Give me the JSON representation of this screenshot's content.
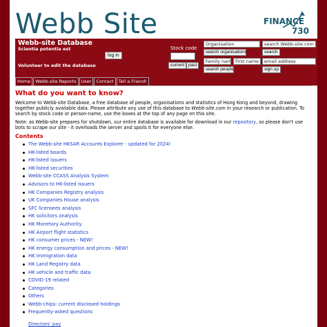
{
  "header": {
    "brand": "Webb Site",
    "finance_logo_top": "FINANCE",
    "finance_logo_num": "730"
  },
  "banner": {
    "title": "Webb-site Database",
    "motto": "Scientia potentia est",
    "login_label": "log in",
    "volunteer": "Volunteer to edit the database",
    "stock_code_label": "Stock code",
    "current_label": "current",
    "past_label": "past",
    "organisation_value": "Organisation",
    "search_orgs_label": "search organisations",
    "family_name_value": "Family name",
    "first_name_value": "First name",
    "search_people_label": "search people",
    "site_search_value": "search Webb-site.com",
    "search_label": "search",
    "email_value": "email address",
    "signup_label": "sign up"
  },
  "nav": {
    "tabs": [
      {
        "label": "Home"
      },
      {
        "label": "Webb-site Reports"
      },
      {
        "label": "User"
      },
      {
        "label": "Contact"
      },
      {
        "label": "Tell a Friend!"
      }
    ]
  },
  "main": {
    "heading": "What do you want to know?",
    "intro_part1": "Welcome to Webb-site Database, a free database of people, organisations and statistics of Hong Kong and beyond, drawing together publicly available data. Please attribute any use of this database to ",
    "intro_em": "Webb-site.com",
    "intro_part2": " in your research or publication. To search by stock code or person-name, use the boxes at the top of any page on this site.",
    "note_part1": "Note: as Webb-site prepares for shutdown, our entire database is available for download in our ",
    "note_link": "repository",
    "note_part2": ", so please don't use bots to scrape our site - it overloads the server and spoils it for everyone else.",
    "contents_heading": "Contents",
    "contents": [
      {
        "label": "The Webb-site HKSAR Accounts Explorer - updated for 2024!"
      },
      {
        "label": "HK-listed boards"
      },
      {
        "label": "HK-listed issuers"
      },
      {
        "label": "HK-listed securities"
      },
      {
        "label": "Webb-site CCASS Analysis System"
      },
      {
        "label": "Advisors to HK-listed issuers"
      },
      {
        "label": "HK Companies Registry analysis"
      },
      {
        "label": "UK Companies House analysis"
      },
      {
        "label": "SFC licensees analysis"
      },
      {
        "label": "HK solicitors analysis"
      },
      {
        "label": "HK Monetary Authority"
      },
      {
        "label": "HK Airport flight statistics"
      },
      {
        "label": "HK consumer prices - NEW!"
      },
      {
        "label": "HK energy consumption and prices - NEW!"
      },
      {
        "label": "HK immigration data"
      },
      {
        "label": "HK Land Registry data"
      },
      {
        "label": "HK vehicle and traffic data"
      },
      {
        "label": "COVID-19 related"
      },
      {
        "label": "Categories"
      },
      {
        "label": "Others"
      },
      {
        "label": "Webb-chips: current disclosed holdings"
      },
      {
        "label": "Frequently-asked questions"
      }
    ],
    "next_item": "Directors' pay"
  },
  "colors": {
    "brand_teal": "#1c5a6e",
    "banner_red": "#8b0a14",
    "heading_red": "#cc0000",
    "link_blue": "#1a3cc8",
    "page_bg": "#7a0010"
  }
}
